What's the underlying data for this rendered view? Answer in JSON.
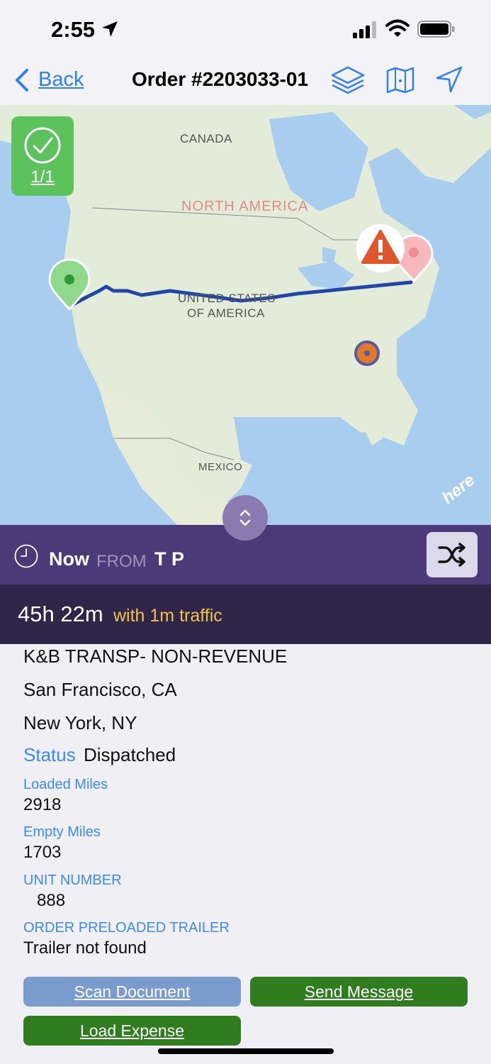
{
  "status_bar": {
    "time": "2:55"
  },
  "nav": {
    "back_label": "Back",
    "title": "Order #2203033-01",
    "icons": [
      "layers-icon",
      "map-fold-icon",
      "navigation-arrow-icon"
    ]
  },
  "map": {
    "labels": {
      "canada": "CANADA",
      "north_america": "NORTH AMERICA",
      "usa_line1": "UNITED STATES",
      "usa_line2": "OF AMERICA",
      "mexico": "MEXICO"
    },
    "stop_badge": {
      "count": "1/1"
    },
    "attribution": "here",
    "colors": {
      "route": "#2246a8",
      "origin_pin": "#7fd17a",
      "destination_pin": "#f3a3a9",
      "warning": "#e0552a",
      "current_location": "#e07a2a"
    }
  },
  "trip": {
    "now_label": "Now",
    "from_label": "FROM",
    "from_value": "T P",
    "eta": "45h 22m",
    "traffic": "with 1m traffic"
  },
  "details": {
    "customer": "K&B TRANSP- NON-REVENUE",
    "origin": "San Francisco, CA",
    "destination": "New York, NY",
    "status_label": "Status",
    "status_value": "Dispatched",
    "loaded_miles_label": "Loaded Miles",
    "loaded_miles_value": "2918",
    "empty_miles_label": "Empty Miles",
    "empty_miles_value": "1703",
    "unit_number_label": "UNIT NUMBER",
    "unit_number_value": "888",
    "trailer_label": "ORDER PRELOADED TRAILER",
    "trailer_value": "Trailer not found"
  },
  "actions": {
    "scan_document": "Scan Document",
    "send_message": "Send Message",
    "load_expense": "Load Expense"
  }
}
